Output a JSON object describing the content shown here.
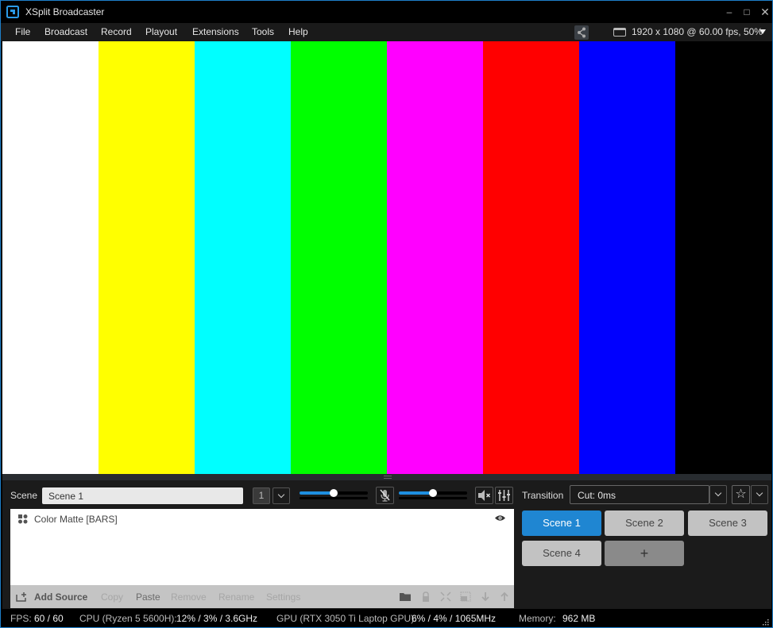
{
  "window": {
    "title": "XSplit Broadcaster",
    "controls": {
      "minimize": "–",
      "maximize": "□",
      "close": "✕"
    }
  },
  "menu": {
    "items": [
      "File",
      "Broadcast",
      "Record",
      "Playout",
      "Extensions",
      "Tools",
      "Help"
    ],
    "resolution": "1920 x 1080 @ 60.00 fps, 50%"
  },
  "preview": {
    "bars": [
      "#ffffff",
      "#ffff00",
      "#00ffff",
      "#00ff00",
      "#ff00ff",
      "#ff0000",
      "#0000ff",
      "#000000"
    ]
  },
  "scene_bar": {
    "label": "Scene",
    "name_value": "Scene 1",
    "layer_number": "1",
    "mic_volume": 0.5,
    "speaker_volume": 0.5
  },
  "sources": {
    "items": [
      {
        "name": "Color Matte [BARS]",
        "visible": true
      }
    ],
    "toolbar": {
      "add_source": "Add Source",
      "copy": "Copy",
      "paste": "Paste",
      "remove": "Remove",
      "rename": "Rename",
      "settings": "Settings"
    }
  },
  "transition": {
    "label": "Transition",
    "value": "Cut: 0ms",
    "favorite_icon": "☆"
  },
  "scenes": {
    "items": [
      "Scene 1",
      "Scene 2",
      "Scene 3",
      "Scene 4"
    ],
    "active": "Scene 1",
    "add_label": "+"
  },
  "status": {
    "fps_label": "FPS:",
    "fps_value": "60 / 60",
    "cpu_label": "CPU (Ryzen 5 5600H):",
    "cpu_value": "12% / 3% / 3.6GHz",
    "gpu_label": "GPU (RTX 3050 Ti Laptop GPU):",
    "gpu_value": "6% / 4% / 1065MHz",
    "memory_label": "Memory:",
    "memory_value": "962 MB"
  },
  "colors": {
    "accent": "#1f86d2",
    "window_border": "#1e7fc9"
  }
}
